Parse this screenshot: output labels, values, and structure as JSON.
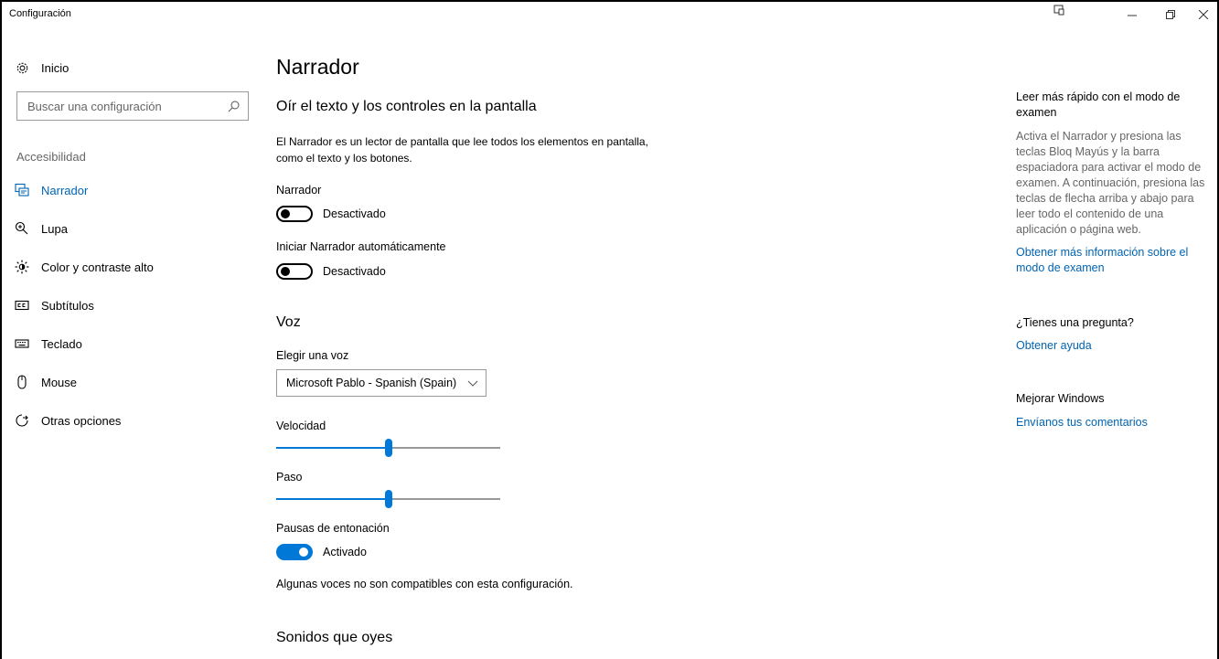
{
  "window": {
    "title": "Configuración"
  },
  "sidebar": {
    "home_label": "Inicio",
    "search_placeholder": "Buscar una configuración",
    "section_label": "Accesibilidad",
    "items": [
      {
        "label": "Narrador",
        "icon": "narrator-icon",
        "active": true
      },
      {
        "label": "Lupa",
        "icon": "magnifier-icon",
        "active": false
      },
      {
        "label": "Color y contraste alto",
        "icon": "brightness-icon",
        "active": false
      },
      {
        "label": "Subtítulos",
        "icon": "closed-captions-icon",
        "active": false
      },
      {
        "label": "Teclado",
        "icon": "keyboard-icon",
        "active": false
      },
      {
        "label": "Mouse",
        "icon": "mouse-icon",
        "active": false
      },
      {
        "label": "Otras opciones",
        "icon": "other-options-icon",
        "active": false
      }
    ]
  },
  "main": {
    "title": "Narrador",
    "subtitle": "Oír el texto y los controles en la pantalla",
    "description": "El Narrador es un lector de pantalla que lee todos los elementos en pantalla, como el texto y los botones.",
    "narrator_label": "Narrador",
    "narrator_toggle": {
      "state": "Desactivado",
      "on": false
    },
    "autostart_label": "Iniciar Narrador automáticamente",
    "autostart_toggle": {
      "state": "Desactivado",
      "on": false
    },
    "voice_heading": "Voz",
    "choose_voice_label": "Elegir una voz",
    "voice_selected": "Microsoft Pablo - Spanish (Spain)",
    "speed_label": "Velocidad",
    "speed_value": 0.5,
    "pitch_label": "Paso",
    "pitch_value": 0.5,
    "intonation_label": "Pausas de entonación",
    "intonation_toggle": {
      "state": "Activado",
      "on": true
    },
    "note": "Algunas voces no son compatibles con esta configuración.",
    "sounds_heading": "Sonidos que oyes"
  },
  "right_panel": {
    "scan_heading": "Leer más rápido con el modo de examen",
    "scan_text": "Activa el Narrador y presiona las teclas Bloq Mayús y la barra espaciadora para activar el modo de examen. A continuación, presiona las teclas de flecha arriba y abajo para leer todo el contenido de una aplicación o página web.",
    "scan_link": "Obtener más información sobre el modo de examen",
    "question_heading": "¿Tienes una pregunta?",
    "help_link": "Obtener ayuda",
    "improve_heading": "Mejorar Windows",
    "feedback_link": "Envíanos tus comentarios"
  },
  "colors": {
    "accent": "#0078d7",
    "link": "#0063b1",
    "secondary_text": "#666666"
  }
}
